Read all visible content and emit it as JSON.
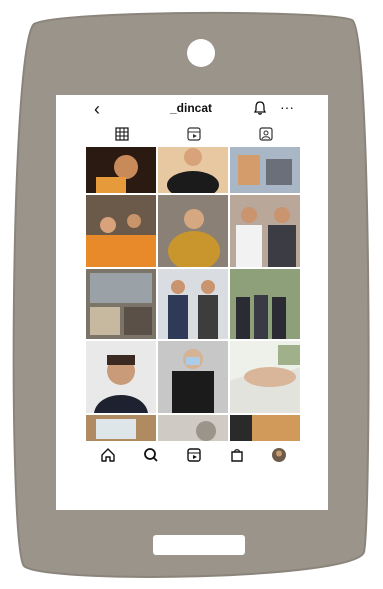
{
  "profile": {
    "back_icon": "chevron-left-icon",
    "username": "_dincat",
    "bell_icon": "bell-icon",
    "more_icon": "more-horizontal-icon"
  },
  "tabs": [
    {
      "name": "grid",
      "icon": "grid-icon"
    },
    {
      "name": "reels",
      "icon": "reels-icon"
    },
    {
      "name": "tagged",
      "icon": "tagged-icon"
    }
  ],
  "bottom_nav": [
    {
      "name": "home",
      "icon": "home-icon"
    },
    {
      "name": "search",
      "icon": "search-icon"
    },
    {
      "name": "reels",
      "icon": "reels-icon"
    },
    {
      "name": "shop",
      "icon": "shop-icon"
    },
    {
      "name": "profile",
      "icon": "avatar-icon"
    }
  ],
  "colors": {
    "phone_shell": "#9a948b",
    "screen_bg": "#ffffff",
    "text": "#111111"
  }
}
